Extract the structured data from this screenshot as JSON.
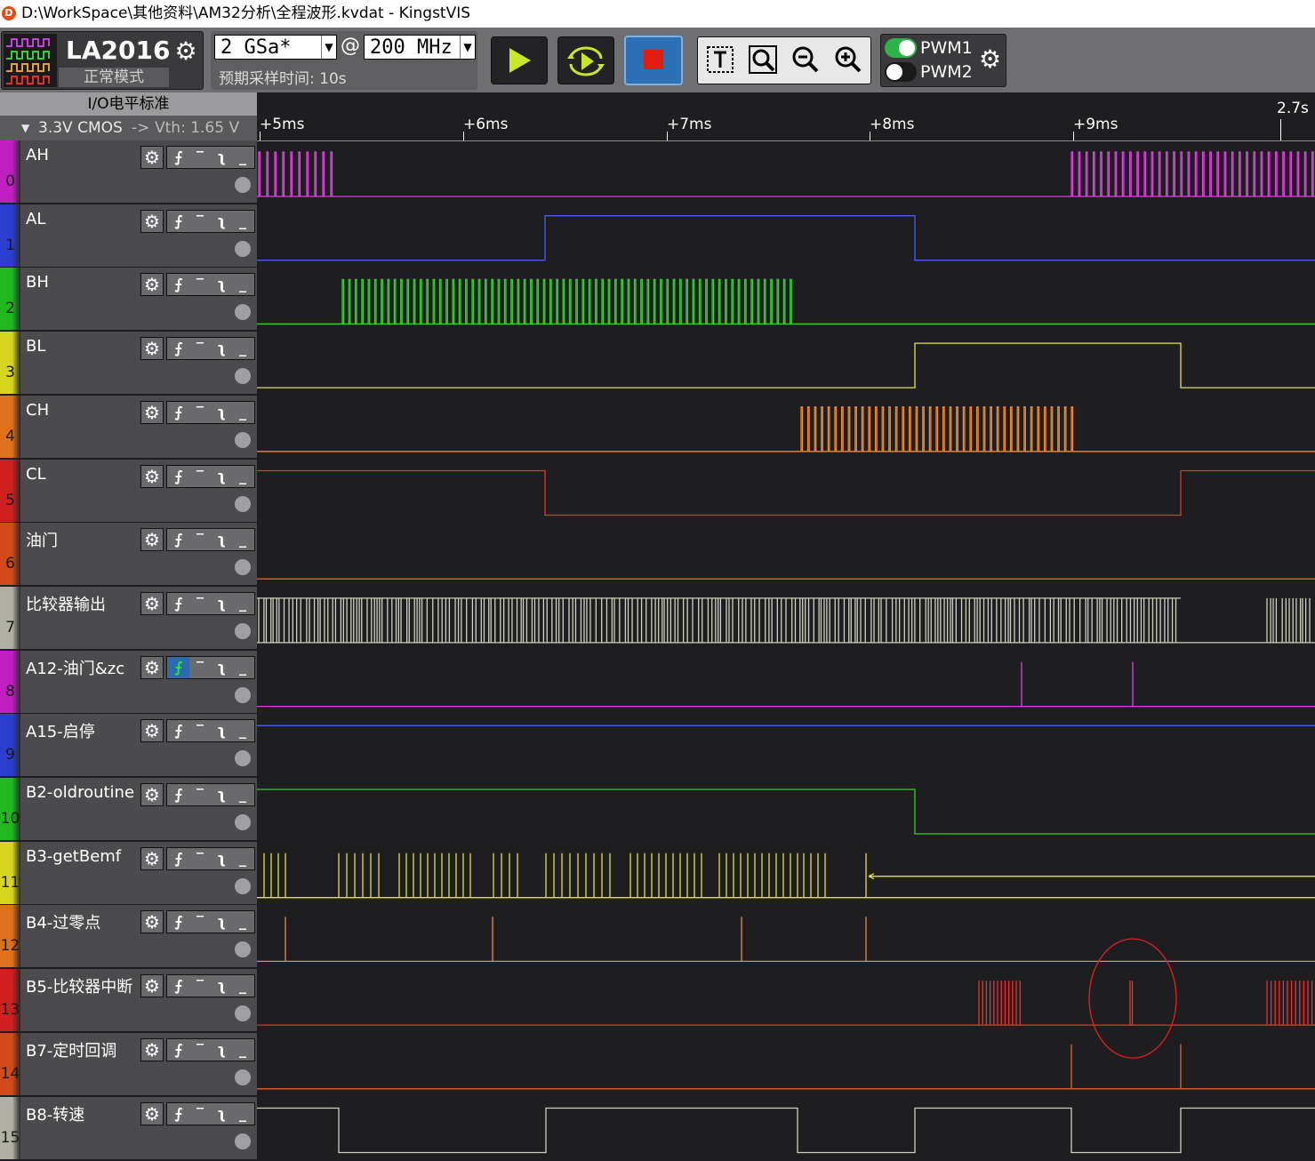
{
  "window": {
    "title": "D:\\WorkSpace\\其他资料\\AM32分析\\全程波形.kvdat - KingstVIS",
    "icon": "kingst-logo-icon"
  },
  "device": {
    "name": "LA2016",
    "mode": "正常模式"
  },
  "sampling": {
    "rate": "2 GSa*",
    "at": "@",
    "frequency": "200 MHz",
    "estimated_time": "预期采样时间: 10s"
  },
  "pwm": {
    "pwm1_label": "PWM1",
    "pwm1_on": true,
    "pwm2_label": "PWM2",
    "pwm2_on": false
  },
  "io_standard": {
    "title": "I/O电平标准",
    "voltage": "3.3V CMOS",
    "arrow": "->",
    "threshold": "Vth: 1.65 V"
  },
  "time_axis": {
    "labels": [
      "+5ms",
      "+6ms",
      "+7ms",
      "+8ms",
      "+9ms",
      "2.7s"
    ]
  },
  "channels": [
    {
      "num": "0",
      "name": "AH",
      "color": "#e040e0",
      "stripe": "#c21fc2"
    },
    {
      "num": "1",
      "name": "AL",
      "color": "#4460e8",
      "stripe": "#2a3ed0"
    },
    {
      "num": "2",
      "name": "BH",
      "color": "#33d033",
      "stripe": "#1fb81f"
    },
    {
      "num": "3",
      "name": "BL",
      "color": "#e3e33a",
      "stripe": "#d6d61f"
    },
    {
      "num": "4",
      "name": "CH",
      "color": "#f08a2e",
      "stripe": "#e0701a"
    },
    {
      "num": "5",
      "name": "CL",
      "color": "#e83232",
      "stripe": "#d01f1f"
    },
    {
      "num": "6",
      "name": "油门",
      "color": "#e8602a",
      "stripe": "#d24a1a"
    },
    {
      "num": "7",
      "name": "比较器输出",
      "color": "#cfcfc0",
      "stripe": "#b0b0a4"
    },
    {
      "num": "8",
      "name": "A12-油门&zc",
      "color": "#e040e0",
      "stripe": "#c21fc2"
    },
    {
      "num": "9",
      "name": "A15-启停",
      "color": "#4460e8",
      "stripe": "#2a3ed0"
    },
    {
      "num": "10",
      "name": "B2-oldroutine",
      "color": "#33d033",
      "stripe": "#1fb81f"
    },
    {
      "num": "11",
      "name": "B3-getBemf",
      "color": "#e3e33a",
      "stripe": "#d6d61f"
    },
    {
      "num": "12",
      "name": "B4-过零点",
      "color": "#f08a2e",
      "stripe": "#e0701a"
    },
    {
      "num": "13",
      "name": "B5-比较器中断",
      "color": "#e83232",
      "stripe": "#d01f1f"
    },
    {
      "num": "14",
      "name": "B7-定时回调",
      "color": "#e8602a",
      "stripe": "#d24a1a"
    },
    {
      "num": "15",
      "name": "B8-转速",
      "color": "#cfcfc0",
      "stripe": "#b0b0a4"
    }
  ],
  "icons": {
    "gear": "gear-icon",
    "text_tool": "text-cursor-icon",
    "zoom_fit": "zoom-fit-icon",
    "zoom_out": "zoom-out-icon",
    "zoom_in": "zoom-in-icon"
  }
}
